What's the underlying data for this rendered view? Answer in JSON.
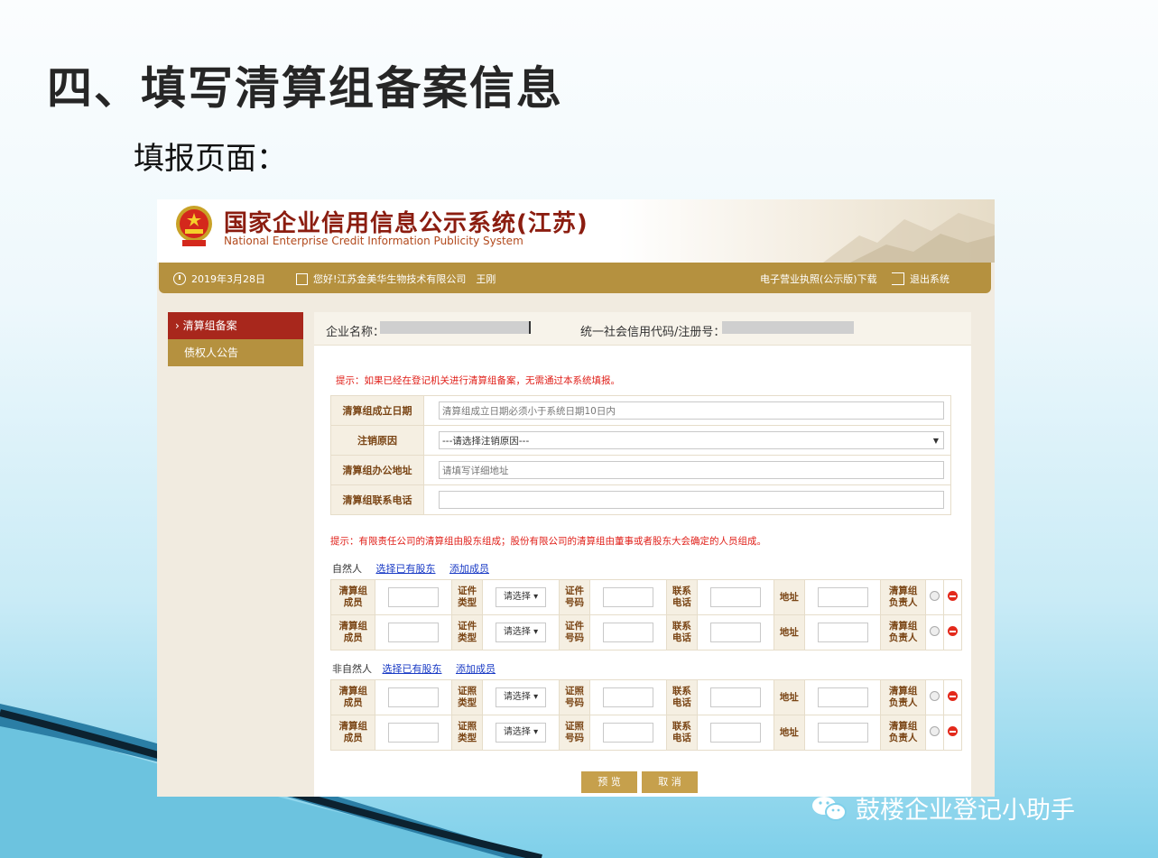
{
  "slide": {
    "title": "四、填写清算组备案信息",
    "subtitle": "填报页面：",
    "watermark": "鼓楼企业登记小助手"
  },
  "header": {
    "title": "国家企业信用信息公示系统(江苏)",
    "subtitle_en": "National Enterprise Credit Information Publicity System"
  },
  "topbar": {
    "date": "2019年3月28日",
    "greeting": "您好!江苏金美华生物技术有限公司　王刚",
    "download": "电子营业执照(公示版)下载",
    "logout": "退出系统"
  },
  "sidebar": {
    "items": [
      {
        "label": "清算组备案",
        "active": true
      },
      {
        "label": "债权人公告",
        "active": false
      }
    ]
  },
  "enterprise": {
    "name_label": "企业名称：",
    "code_label": "统一社会信用代码/注册号："
  },
  "tips": {
    "tip1": "提示：如果已经在登记机关进行清算组备案，无需通过本系统填报。",
    "tip2": "提示：有限责任公司的清算组由股东组成；股份有限公司的清算组由董事或者股东大会确定的人员组成。"
  },
  "form": {
    "date_label": "清算组成立日期",
    "date_placeholder": "清算组成立日期必须小于系统日期10日内",
    "reason_label": "注销原因",
    "reason_value": "---请选择注销原因---",
    "address_label": "清算组办公地址",
    "address_placeholder": "请填写详细地址",
    "phone_label": "清算组联系电话",
    "phone_value": ""
  },
  "natural": {
    "label": "自然人",
    "select_link": "选择已有股东",
    "add_link": "添加成员"
  },
  "nonnatural": {
    "label": "非自然人",
    "select_link": "选择已有股东",
    "add_link": "添加成员"
  },
  "member_labels": {
    "member_1": "清算组",
    "member_2": "成员",
    "idtype_1": "证件",
    "idtype_2": "类型",
    "idno_1": "证件",
    "idno_2": "号码",
    "lictype_1": "证照",
    "lictype_2": "类型",
    "licno_1": "证照",
    "licno_2": "号码",
    "phone_1": "联系",
    "phone_2": "电话",
    "address": "地址",
    "leader_1": "清算组",
    "leader_2": "负责人",
    "select_placeholder": "请选择"
  },
  "buttons": {
    "preview": "预 览",
    "cancel": "取 消"
  }
}
